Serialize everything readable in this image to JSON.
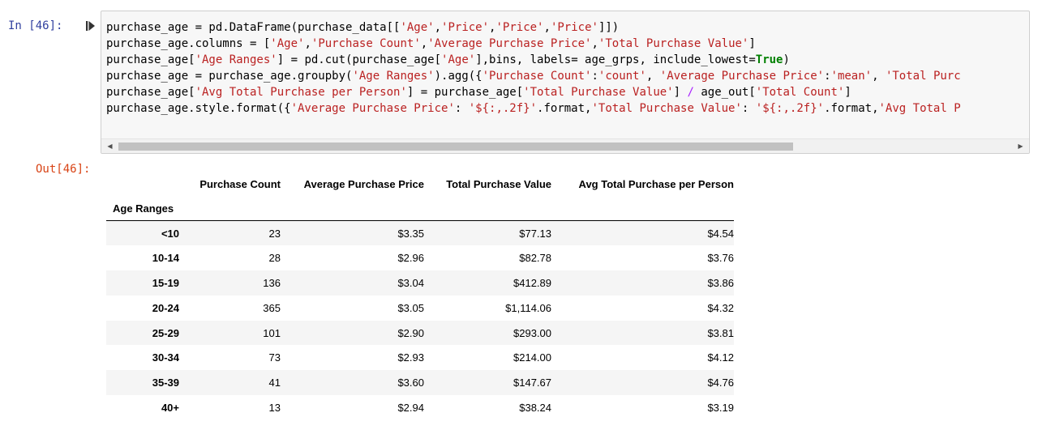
{
  "input": {
    "prompt": "In [46]:",
    "code_lines": [
      [
        {
          "t": "purchase_age = pd.DataFrame(purchase_data[["
        },
        {
          "t": "'Age'",
          "c": "str"
        },
        {
          "t": ","
        },
        {
          "t": "'Price'",
          "c": "str"
        },
        {
          "t": ","
        },
        {
          "t": "'Price'",
          "c": "str"
        },
        {
          "t": ","
        },
        {
          "t": "'Price'",
          "c": "str"
        },
        {
          "t": "]])"
        }
      ],
      [
        {
          "t": "purchase_age.columns = ["
        },
        {
          "t": "'Age'",
          "c": "str"
        },
        {
          "t": ","
        },
        {
          "t": "'Purchase Count'",
          "c": "str"
        },
        {
          "t": ","
        },
        {
          "t": "'Average Purchase Price'",
          "c": "str"
        },
        {
          "t": ","
        },
        {
          "t": "'Total Purchase Value'",
          "c": "str"
        },
        {
          "t": "]"
        }
      ],
      [
        {
          "t": "purchase_age["
        },
        {
          "t": "'Age Ranges'",
          "c": "str"
        },
        {
          "t": "] = pd.cut(purchase_age["
        },
        {
          "t": "'Age'",
          "c": "str"
        },
        {
          "t": "],bins, labels= age_grps, include_lowest="
        },
        {
          "t": "True",
          "c": "kw"
        },
        {
          "t": ")"
        }
      ],
      [
        {
          "t": "purchase_age = purchase_age.groupby("
        },
        {
          "t": "'Age Ranges'",
          "c": "str"
        },
        {
          "t": ").agg({"
        },
        {
          "t": "'Purchase Count'",
          "c": "str"
        },
        {
          "t": ":"
        },
        {
          "t": "'count'",
          "c": "str"
        },
        {
          "t": ", "
        },
        {
          "t": "'Average Purchase Price'",
          "c": "str"
        },
        {
          "t": ":"
        },
        {
          "t": "'mean'",
          "c": "str"
        },
        {
          "t": ", "
        },
        {
          "t": "'Total Purc",
          "c": "str"
        }
      ],
      [
        {
          "t": "purchase_age["
        },
        {
          "t": "'Avg Total Purchase per Person'",
          "c": "str"
        },
        {
          "t": "] = purchase_age["
        },
        {
          "t": "'Total Purchase Value'",
          "c": "str"
        },
        {
          "t": "] "
        },
        {
          "t": "/",
          "c": "op"
        },
        {
          "t": " age_out["
        },
        {
          "t": "'Total Count'",
          "c": "str"
        },
        {
          "t": "]"
        }
      ],
      [
        {
          "t": "purchase_age.style.format({"
        },
        {
          "t": "'Average Purchase Price'",
          "c": "str"
        },
        {
          "t": ": "
        },
        {
          "t": "'${:,.2f}'",
          "c": "str"
        },
        {
          "t": ".format,"
        },
        {
          "t": "'Total Purchase Value'",
          "c": "str"
        },
        {
          "t": ": "
        },
        {
          "t": "'${:,.2f}'",
          "c": "str"
        },
        {
          "t": ".format,"
        },
        {
          "t": "'Avg Total P",
          "c": "str"
        }
      ]
    ]
  },
  "output": {
    "prompt": "Out[46]:",
    "table": {
      "columns": [
        "Purchase Count",
        "Average Purchase Price",
        "Total Purchase Value",
        "Avg Total Purchase per Person"
      ],
      "index_name": "Age Ranges",
      "rows": [
        {
          "index": "<10",
          "cells": [
            "23",
            "$3.35",
            "$77.13",
            "$4.54"
          ]
        },
        {
          "index": "10-14",
          "cells": [
            "28",
            "$2.96",
            "$82.78",
            "$3.76"
          ]
        },
        {
          "index": "15-19",
          "cells": [
            "136",
            "$3.04",
            "$412.89",
            "$3.86"
          ]
        },
        {
          "index": "20-24",
          "cells": [
            "365",
            "$3.05",
            "$1,114.06",
            "$4.32"
          ]
        },
        {
          "index": "25-29",
          "cells": [
            "101",
            "$2.90",
            "$293.00",
            "$3.81"
          ]
        },
        {
          "index": "30-34",
          "cells": [
            "73",
            "$2.93",
            "$214.00",
            "$4.12"
          ]
        },
        {
          "index": "35-39",
          "cells": [
            "41",
            "$3.60",
            "$147.67",
            "$4.76"
          ]
        },
        {
          "index": "40+",
          "cells": [
            "13",
            "$2.94",
            "$38.24",
            "$3.19"
          ]
        }
      ]
    }
  },
  "colors": {
    "in_prompt": "#303f9f",
    "out_prompt": "#d84315",
    "string": "#ba2121",
    "keyword": "#008000",
    "operator": "#aa22ff",
    "code_bg": "#f7f7f7",
    "row_stripe": "#f5f5f5"
  },
  "icons": {
    "run": "run-cell-icon",
    "scroll_left": "scroll-left-arrow-icon",
    "scroll_right": "scroll-right-arrow-icon"
  }
}
